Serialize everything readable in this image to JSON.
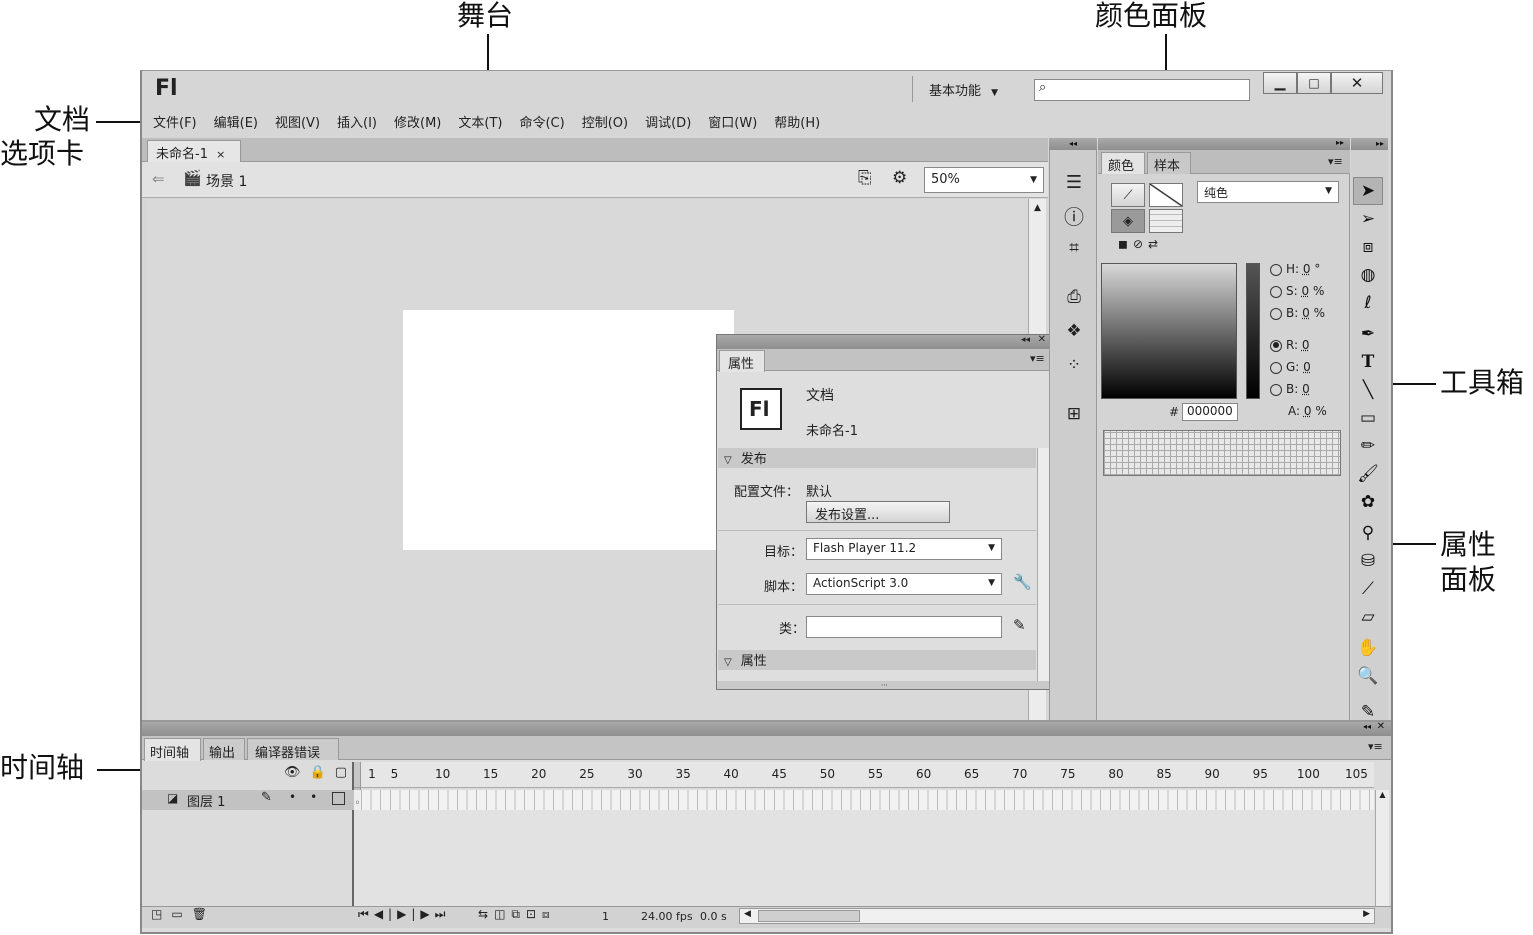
{
  "callouts": {
    "stage": "舞台",
    "color_panel": "颜色面板",
    "doc_tab_line1": "文档",
    "doc_tab_line2": "选项卡",
    "toolbox": "工具箱",
    "props_line1": "属性",
    "props_line2": "面板",
    "timeline": "时间轴"
  },
  "app": {
    "logo": "Fl",
    "workspace": "基本功能",
    "search_icon": "search-icon",
    "min_icon": "minimize-icon",
    "max_icon": "maximize-icon",
    "close_icon": "close-icon"
  },
  "menu": [
    "文件(F)",
    "编辑(E)",
    "视图(V)",
    "插入(I)",
    "修改(M)",
    "文本(T)",
    "命令(C)",
    "控制(O)",
    "调试(D)",
    "窗口(W)",
    "帮助(H)"
  ],
  "doc_tab": {
    "label": "未命名-1",
    "close": "×"
  },
  "scene": {
    "label": "场景 1",
    "zoom": "50%"
  },
  "properties": {
    "tab": "属性",
    "doc_type": "文档",
    "doc_name": "未命名-1",
    "section_publish": "发布",
    "profile_label": "配置文件：",
    "profile_value": "默认",
    "publish_settings": "发布设置...",
    "target_label": "目标：",
    "target_value": "Flash Player 11.2",
    "script_label": "脚本：",
    "script_value": "ActionScript 3.0",
    "class_label": "类：",
    "class_value": "",
    "section_props": "属性"
  },
  "color_panel": {
    "tab_color": "颜色",
    "tab_swatches": "样本",
    "fill_type": "纯色",
    "hsb": [
      {
        "k": "H:",
        "v": "0",
        "u": "°"
      },
      {
        "k": "S:",
        "v": "0",
        "u": "%"
      },
      {
        "k": "B:",
        "v": "0",
        "u": "%"
      }
    ],
    "rgb": [
      {
        "k": "R:",
        "v": "0",
        "u": ""
      },
      {
        "k": "G:",
        "v": "0",
        "u": ""
      },
      {
        "k": "B:",
        "v": "0",
        "u": ""
      }
    ],
    "hex_label": "#",
    "hex": "000000",
    "alpha_label": "A:",
    "alpha": "0",
    "alpha_unit": "%"
  },
  "timeline": {
    "tabs": [
      "时间轴",
      "输出",
      "编译器错误"
    ],
    "layer": "图层 1",
    "ticks": [
      "1",
      "5",
      "10",
      "15",
      "20",
      "25",
      "30",
      "35",
      "40",
      "45",
      "50",
      "55",
      "60",
      "65",
      "70",
      "75",
      "80",
      "85",
      "90",
      "95",
      "100",
      "105"
    ],
    "frame": "1",
    "fps": "24.00 fps",
    "time": "0.0 s"
  },
  "toolbox": [
    "selection-tool-icon",
    "subselection-tool-icon",
    "free-transform-icon",
    "3d-rotation-icon",
    "lasso-icon",
    "pen-icon",
    "text-tool-icon",
    "line-tool-icon",
    "rectangle-tool-icon",
    "pencil-icon",
    "brush-icon",
    "deco-icon",
    "bone-icon",
    "paint-bucket-icon",
    "eyedropper-icon",
    "eraser-icon",
    "hand-icon",
    "zoom-icon",
    "stroke-color-icon"
  ],
  "colors": {
    "chrome": "#d6d6d6",
    "stage": "#ffffff",
    "pasteboard": "#d9d9d9"
  }
}
